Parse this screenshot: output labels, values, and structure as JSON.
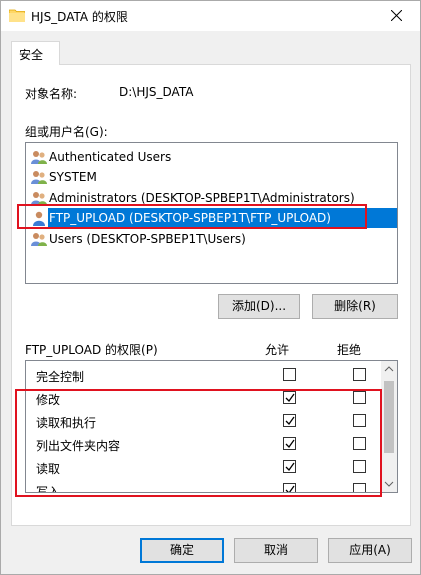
{
  "window": {
    "title": "HJS_DATA 的权限"
  },
  "tabs": [
    {
      "label": "安全"
    }
  ],
  "object": {
    "label": "对象名称:",
    "value": "D:\\HJS_DATA"
  },
  "groups": {
    "label": "组或用户名(G):",
    "items": [
      {
        "label": "Authenticated Users",
        "selected": false
      },
      {
        "label": "SYSTEM",
        "selected": false
      },
      {
        "label": "Administrators (DESKTOP-SPBEP1T\\Administrators)",
        "selected": false
      },
      {
        "label": "FTP_UPLOAD (DESKTOP-SPBEP1T\\FTP_UPLOAD)",
        "selected": true
      },
      {
        "label": "Users (DESKTOP-SPBEP1T\\Users)",
        "selected": false
      }
    ]
  },
  "buttons": {
    "add": "添加(D)...",
    "remove": "删除(R)",
    "ok": "确定",
    "cancel": "取消",
    "apply": "应用(A)"
  },
  "permissions": {
    "label": "FTP_UPLOAD 的权限(P)",
    "allow_header": "允许",
    "deny_header": "拒绝",
    "rows": [
      {
        "label": "完全控制",
        "allow": false,
        "deny": false
      },
      {
        "label": "修改",
        "allow": true,
        "deny": false
      },
      {
        "label": "读取和执行",
        "allow": true,
        "deny": false
      },
      {
        "label": "列出文件夹内容",
        "allow": true,
        "deny": false
      },
      {
        "label": "读取",
        "allow": true,
        "deny": false
      },
      {
        "label": "写入",
        "allow": true,
        "deny": false
      }
    ]
  },
  "colors": {
    "selection": "#0078d7",
    "annotation": "#e0121f"
  }
}
